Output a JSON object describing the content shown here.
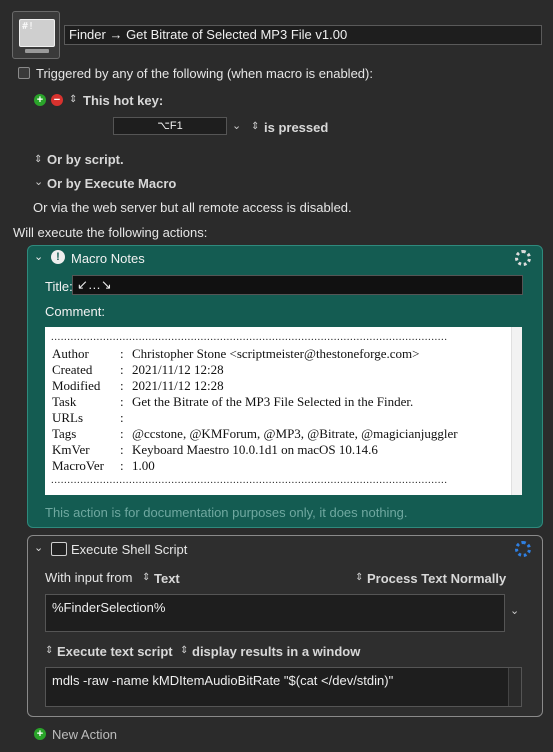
{
  "macro": {
    "name": "Finder → Get Bitrate of Selected MP3 File v1.00"
  },
  "trigger": {
    "header": "Triggered by any of the following (when macro is enabled):",
    "hotkey_label": "This hot key:",
    "hotkey_value": "⌥F1",
    "hotkey_state": "is pressed",
    "or_script": "Or by script.",
    "or_execute": "Or by Execute Macro",
    "web_server": "Or via the web server but all remote access is disabled."
  },
  "actions_header": "Will execute the following actions:",
  "notes": {
    "title": "Macro Notes",
    "title_label": "Title:",
    "title_value": "↙…↘",
    "comment_label": "Comment:",
    "dots": "..........................................................................................................................",
    "rows": [
      {
        "key": "Author",
        "value": "Christopher Stone <scriptmeister@thestoneforge.com>"
      },
      {
        "key": "Created",
        "value": "2021/11/12 12:28"
      },
      {
        "key": "Modified",
        "value": "2021/11/12 12:28"
      },
      {
        "key": "Task",
        "value": "Get the Bitrate of the MP3 File Selected in the Finder."
      },
      {
        "key": "URLs",
        "value": ""
      },
      {
        "key": "Tags",
        "value": "@ccstone, @KMForum, @MP3, @Bitrate, @magicianjuggler"
      },
      {
        "key": "KmVer",
        "value": "Keyboard Maestro 10.0.1d1 on macOS 10.14.6"
      },
      {
        "key": "MacroVer",
        "value": "1.00"
      }
    ],
    "footer": "This action is for documentation purposes only, it does nothing."
  },
  "shell": {
    "title": "Execute Shell Script",
    "input_label": "With input from",
    "input_source": "Text",
    "process": "Process Text Normally",
    "input_value": "%FinderSelection%",
    "exec_mode": "Execute text script",
    "display_mode": "display results in a window",
    "script": "mdls -raw -name kMDItemAudioBitRate \"$(cat </dev/stdin)\""
  },
  "new_action": "New Action",
  "colors": {
    "notes_bg": "#145c52",
    "window_bg": "#2b2b2b"
  }
}
